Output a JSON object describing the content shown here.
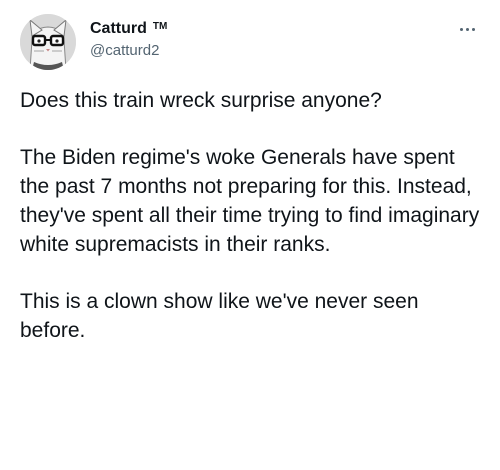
{
  "author": {
    "display_name": "Catturd",
    "trademark": "TM",
    "handle": "@catturd2"
  },
  "icons": {
    "avatar": "cat-with-glasses-avatar",
    "more": "more-options-icon"
  },
  "tweet": {
    "paragraphs": [
      "Does this train wreck surprise anyone?",
      "The Biden regime's woke Generals have spent the past 7 months not preparing for this. Instead, they've spent all their time trying to find imaginary white supremacists in their ranks.",
      "This is a clown show like we've never seen before."
    ]
  },
  "colors": {
    "text": "#0f1419",
    "secondary": "#536471",
    "background": "#ffffff"
  }
}
